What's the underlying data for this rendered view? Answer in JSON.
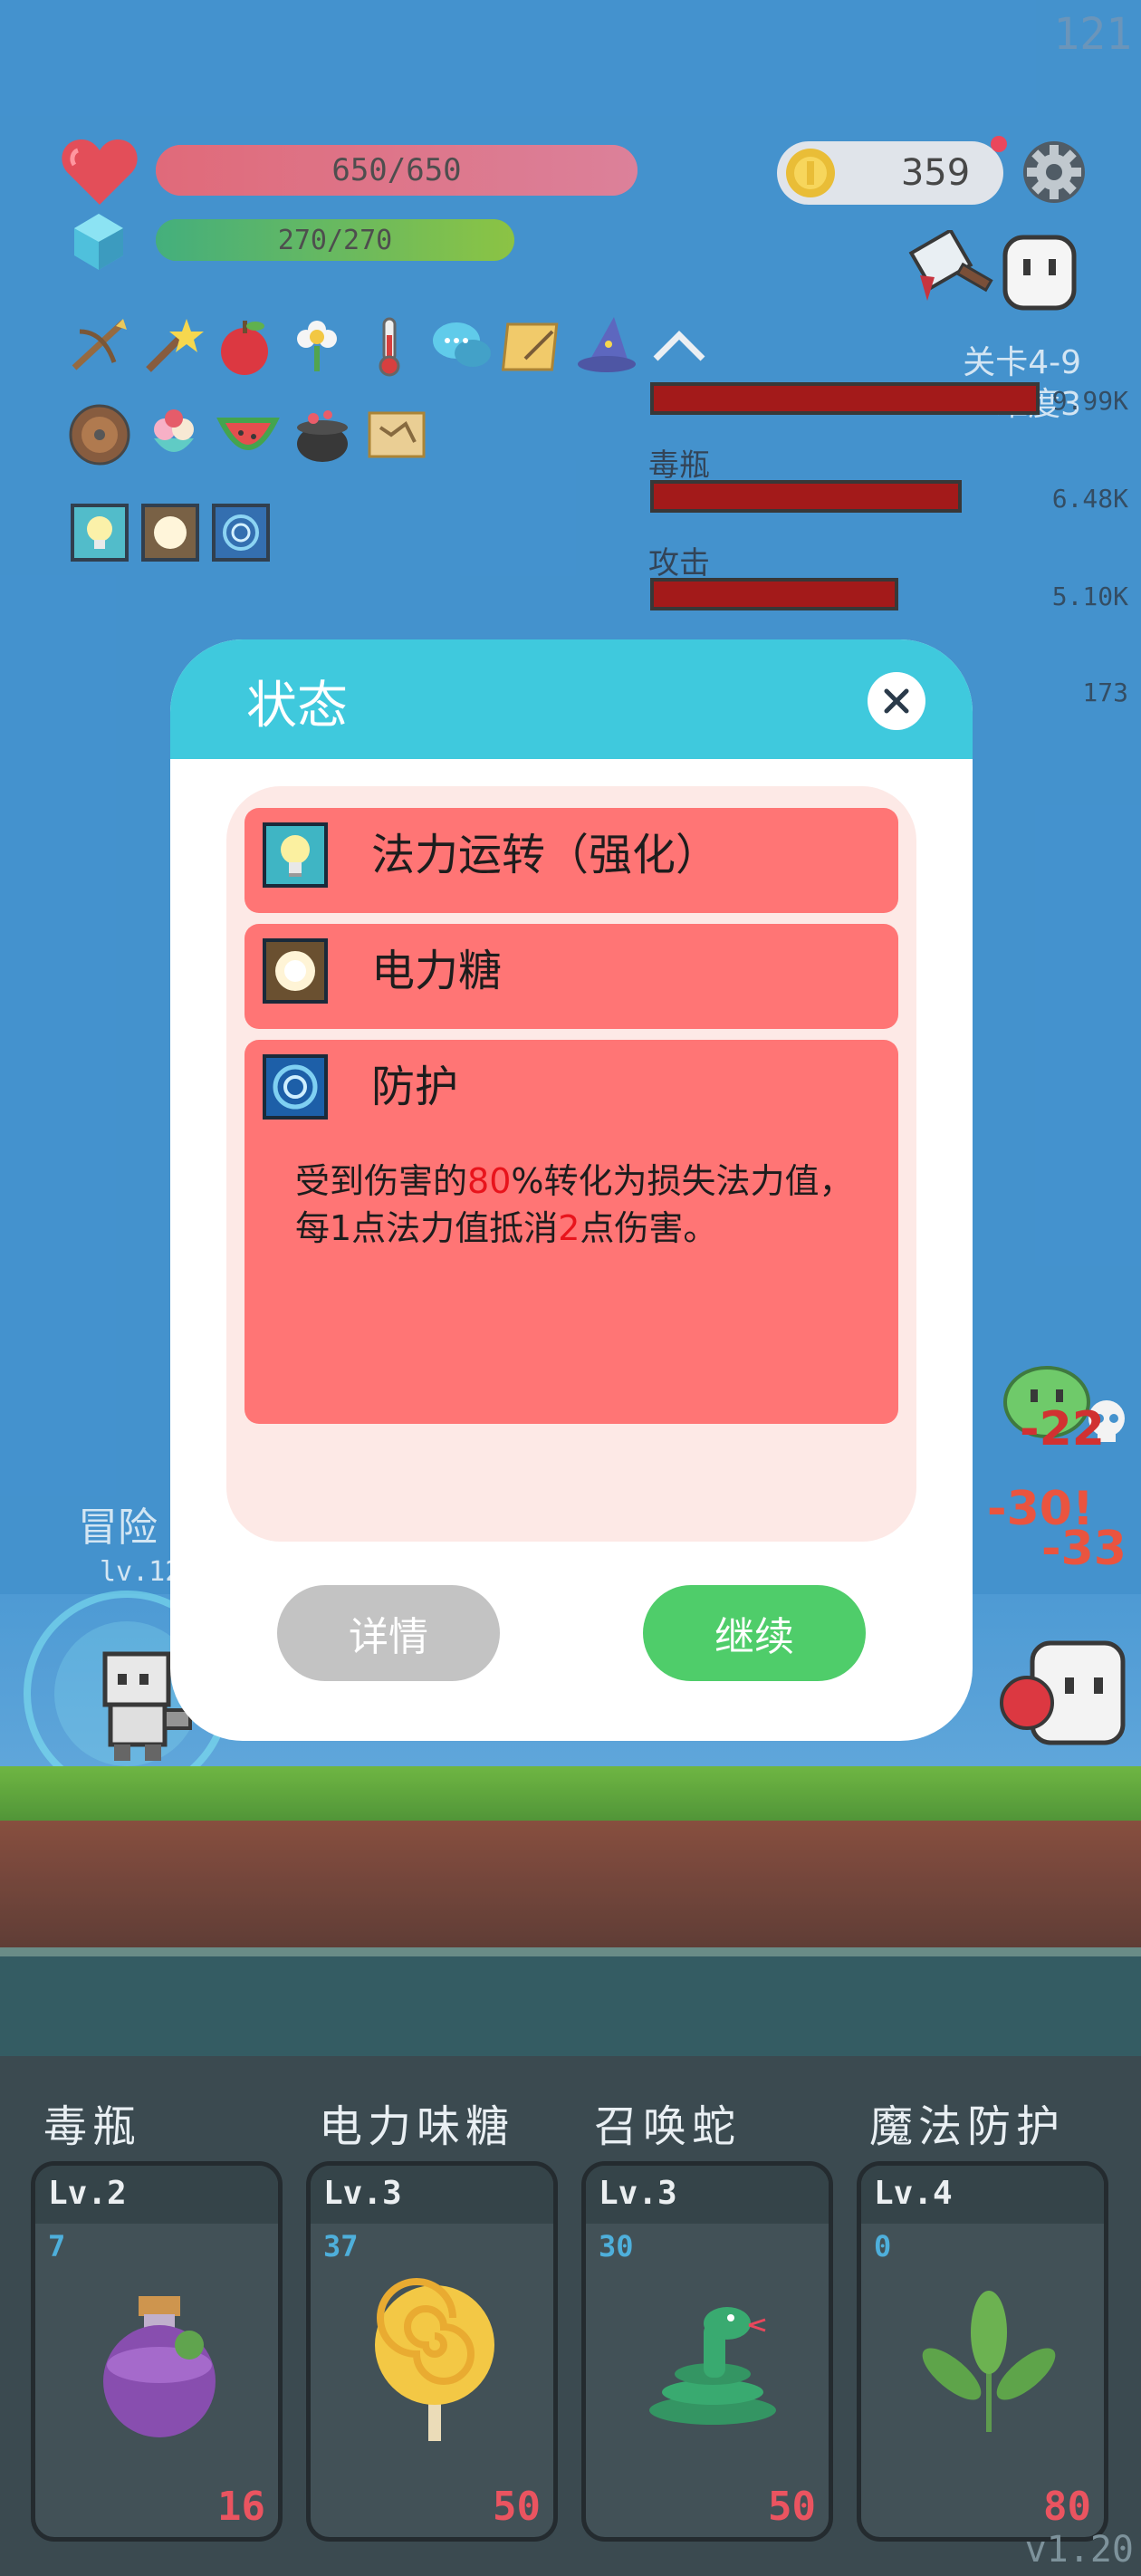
{
  "hud": {
    "fps": "121",
    "hp": {
      "text": "650/650",
      "fill": 1.0
    },
    "mp": {
      "text": "270/270",
      "fill": 1.0
    },
    "coins": "359",
    "stage": "关卡4-9",
    "difficulty": "难度3"
  },
  "items": {
    "row1": [
      "crossbow-icon",
      "magic-wand-icon",
      "apple-icon",
      "flower-icon",
      "thermometer-icon",
      "chat-bubble-icon",
      "scroll-icon",
      "wizard-hat-icon",
      "collapse-chevron-icon"
    ],
    "row2": [
      "shield-icon",
      "ice-cream-icon",
      "watermelon-icon",
      "cauldron-icon",
      "treasure-map-icon"
    ],
    "buffs": [
      "lightbulb-buff-icon",
      "electric-candy-buff-icon",
      "vortex-shield-buff-icon"
    ]
  },
  "damage_stats": [
    {
      "label": "",
      "value": "9.99K",
      "fill": 1.0
    },
    {
      "label": "毒瓶",
      "value": "6.48K",
      "fill": 0.65
    },
    {
      "label": "攻击",
      "value": "5.10K",
      "fill": 0.51
    },
    {
      "label": "",
      "value": "173",
      "fill": 0.02
    }
  ],
  "battle": {
    "hero_label": "冒险",
    "hero_level": "lv.12",
    "floating": [
      "-22",
      "-30!",
      "-33"
    ]
  },
  "modal": {
    "title": "状态",
    "statuses": [
      {
        "name": "法力运转（强化）",
        "icon": "lightbulb-icon"
      },
      {
        "name": "电力糖",
        "icon": "electric-candy-icon"
      },
      {
        "name": "防护",
        "icon": "vortex-shield-icon",
        "desc": {
          "a": "受到伤害的",
          "b": "80",
          "c": "%转化为损失法力值，每1点法力值抵消",
          "d": "2",
          "e": "点伤害。"
        }
      }
    ],
    "detail_button": "详情",
    "continue_button": "继续"
  },
  "skills": [
    {
      "name": "毒瓶",
      "level": "Lv.2",
      "count": "7",
      "cost": "16",
      "icon": "poison-bottle-icon"
    },
    {
      "name": "电力味糖",
      "level": "Lv.3",
      "count": "37",
      "cost": "50",
      "icon": "lollipop-icon"
    },
    {
      "name": "召唤蛇",
      "level": "Lv.3",
      "count": "30",
      "cost": "50",
      "icon": "snake-icon"
    },
    {
      "name": "魔法防护",
      "level": "Lv.4",
      "count": "0",
      "cost": "80",
      "icon": "leaf-icon"
    }
  ],
  "version": "v1.20",
  "colors": {
    "sky": "#2f86c8",
    "hp": "#dd5a6b",
    "mp": "#7fbd2f",
    "modal_header": "#3fc9dd",
    "status_card": "#ff7575",
    "continue": "#4fcd6a",
    "detail": "#c3c3c3",
    "highlight": "#e8141c"
  }
}
